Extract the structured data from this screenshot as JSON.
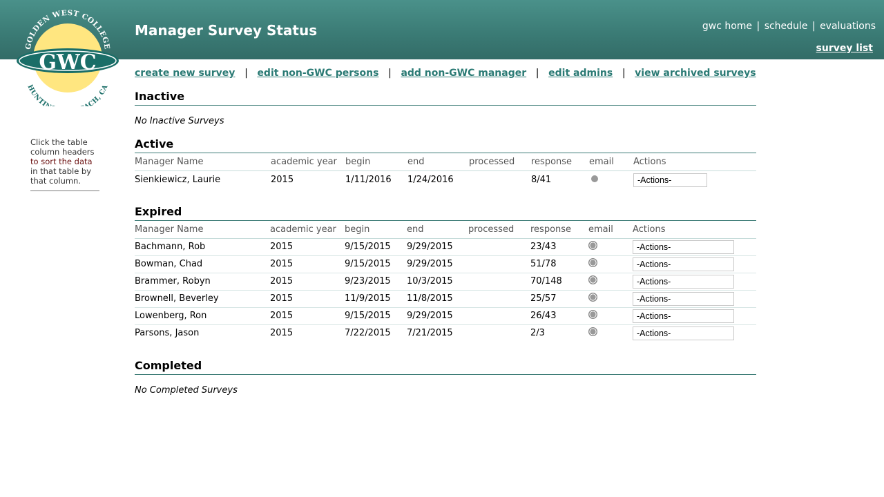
{
  "header": {
    "title": "Manager Survey Status",
    "links": [
      "gwc home",
      "schedule",
      "evaluations"
    ],
    "survey_list": "survey list"
  },
  "logo": {
    "top_text": "GOLDEN WEST COLLEGE",
    "bottom_text": "HUNTINGTON BEACH, CA",
    "abbr": "GWC",
    "colors": {
      "sun": "#ffe680",
      "band": "#1a6e68"
    }
  },
  "sidebar": {
    "help_part1": "Click the table column headers",
    "help_highlight": "to sort the data",
    "help_part2": "in that table by that column."
  },
  "nav": {
    "items": [
      "create new survey",
      "edit non-GWC persons",
      "add non-GWC manager",
      "edit admins",
      "view archived surveys"
    ],
    "separator": "|"
  },
  "columns": [
    "Manager Name",
    "academic year",
    "begin",
    "end",
    "processed",
    "response",
    "email",
    "Actions"
  ],
  "sections": {
    "inactive": {
      "title": "Inactive",
      "empty": "No Inactive Surveys"
    },
    "active": {
      "title": "Active",
      "rows": [
        {
          "name": "Sienkiewicz, Laurie",
          "year": "2015",
          "begin": "1/11/2016",
          "end": "1/24/2016",
          "processed": "",
          "response": "8/41",
          "action": "-Actions-"
        }
      ]
    },
    "expired": {
      "title": "Expired",
      "rows": [
        {
          "name": "Bachmann, Rob",
          "year": "2015",
          "begin": "9/15/2015",
          "end": "9/29/2015",
          "processed": "",
          "response": "23/43",
          "action": "-Actions-"
        },
        {
          "name": "Bowman, Chad",
          "year": "2015",
          "begin": "9/15/2015",
          "end": "9/29/2015",
          "processed": "",
          "response": "51/78",
          "action": "-Actions-"
        },
        {
          "name": "Brammer, Robyn",
          "year": "2015",
          "begin": "9/23/2015",
          "end": "10/3/2015",
          "processed": "",
          "response": "70/148",
          "action": "-Actions-"
        },
        {
          "name": "Brownell, Beverley",
          "year": "2015",
          "begin": "11/9/2015",
          "end": "11/8/2015",
          "processed": "",
          "response": "25/57",
          "action": "-Actions-"
        },
        {
          "name": "Lowenberg, Ron",
          "year": "2015",
          "begin": "9/15/2015",
          "end": "9/29/2015",
          "processed": "",
          "response": "26/43",
          "action": "-Actions-"
        },
        {
          "name": "Parsons, Jason",
          "year": "2015",
          "begin": "7/22/2015",
          "end": "7/21/2015",
          "processed": "",
          "response": "2/3",
          "action": "-Actions-"
        }
      ]
    },
    "completed": {
      "title": "Completed",
      "empty": "No Completed Surveys"
    }
  }
}
